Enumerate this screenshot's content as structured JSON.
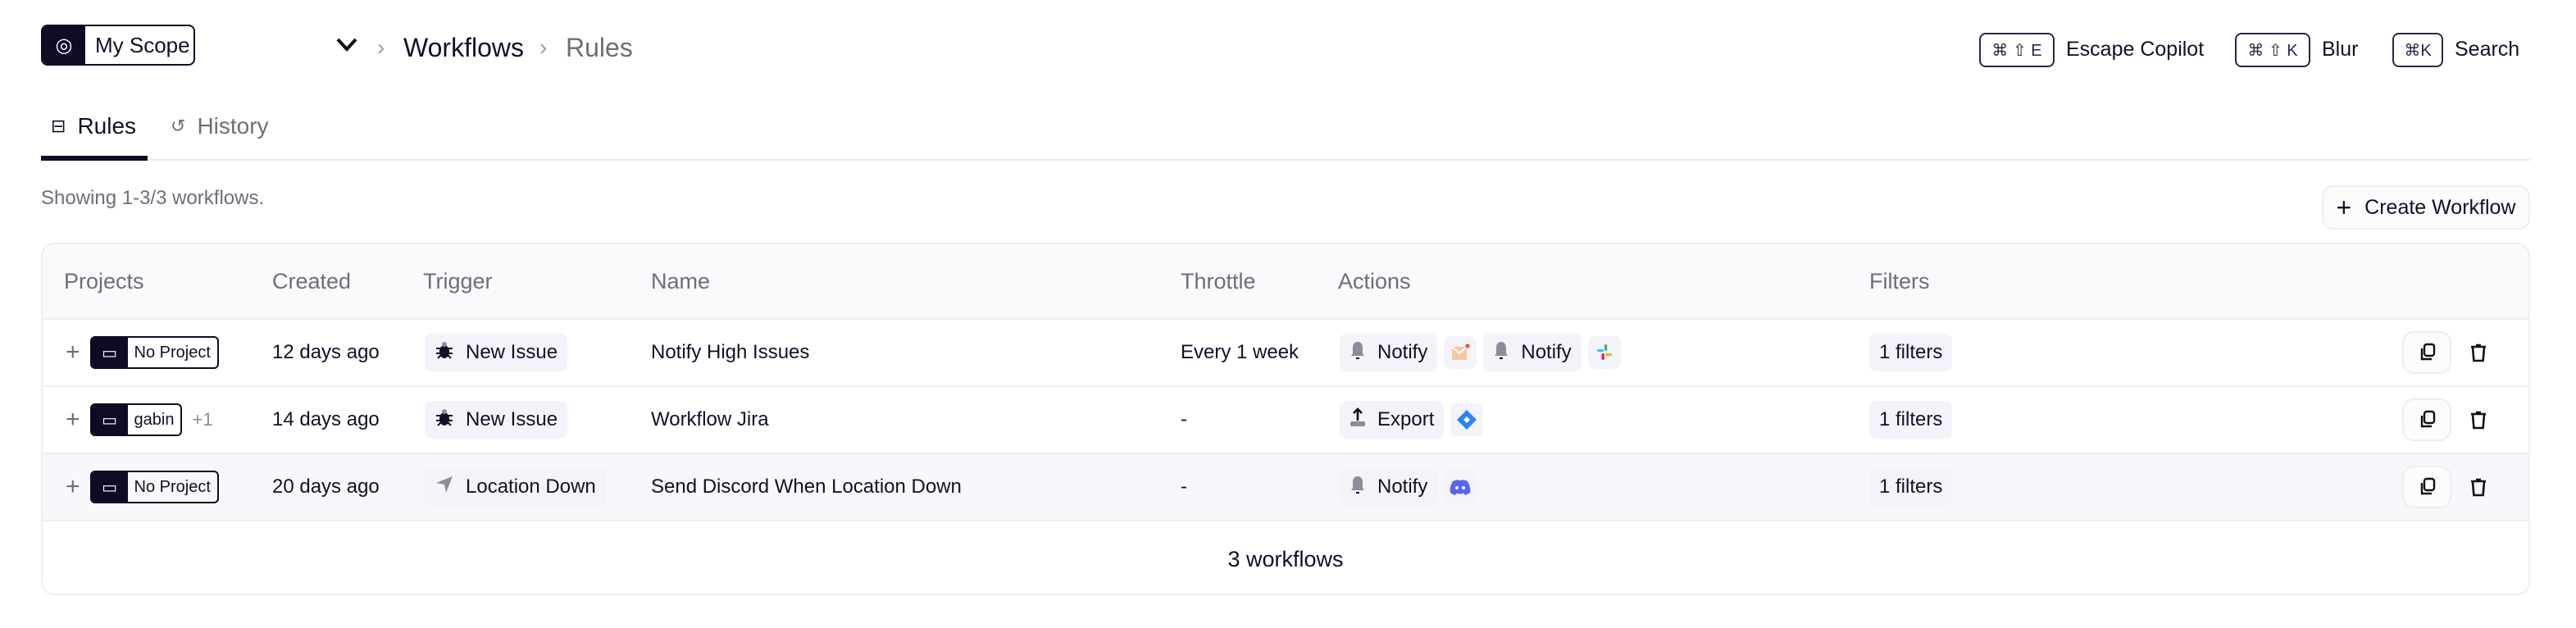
{
  "header": {
    "scope_label": "My Scope",
    "breadcrumb": [
      "Workflows",
      "Rules"
    ],
    "shortcuts": [
      {
        "keys": "⌘ ⇧ E",
        "label": "Escape Copilot"
      },
      {
        "keys": "⌘ ⇧ K",
        "label": "Blur"
      },
      {
        "keys": "⌘K",
        "label": "Search"
      }
    ]
  },
  "tabs": [
    {
      "label": "Rules",
      "icon": "rules-icon",
      "active": true
    },
    {
      "label": "History",
      "icon": "history-icon",
      "active": false
    }
  ],
  "showing": "Showing 1-3/3 workflows.",
  "create_label": "Create Workflow",
  "table": {
    "columns": [
      "Projects",
      "Created",
      "Trigger",
      "Name",
      "Throttle",
      "Actions",
      "Filters"
    ],
    "rows": [
      {
        "project": "No Project",
        "extra": "",
        "created": "12 days ago",
        "trigger": "New Issue",
        "trigger_icon": "bug-icon",
        "name": "Notify High Issues",
        "throttle": "Every 1 week",
        "actions": [
          {
            "label": "Notify",
            "icon": "bell-icon",
            "target": "email-icon"
          },
          {
            "label": "Notify",
            "icon": "bell-icon",
            "target": "slack-icon"
          }
        ],
        "filters": "1 filters"
      },
      {
        "project": "gabin",
        "extra": "+1",
        "created": "14 days ago",
        "trigger": "New Issue",
        "trigger_icon": "bug-icon",
        "name": "Workflow Jira",
        "throttle": "-",
        "actions": [
          {
            "label": "Export",
            "icon": "upload-icon",
            "target": "jira-icon"
          }
        ],
        "filters": "1 filters"
      },
      {
        "project": "No Project",
        "extra": "",
        "created": "20 days ago",
        "trigger": "Location Down",
        "trigger_icon": "location-arrow-icon",
        "name": "Send Discord When Location Down",
        "throttle": "-",
        "actions": [
          {
            "label": "Notify",
            "icon": "bell-icon",
            "target": "discord-icon"
          }
        ],
        "filters": "1 filters"
      }
    ],
    "footer": "3 workflows"
  },
  "colors": {
    "primary": "#0e0b26",
    "chip_bg": "#f4f3fa",
    "jira": "#2684ff",
    "discord": "#5865f2",
    "email": "#f5c9a0"
  }
}
